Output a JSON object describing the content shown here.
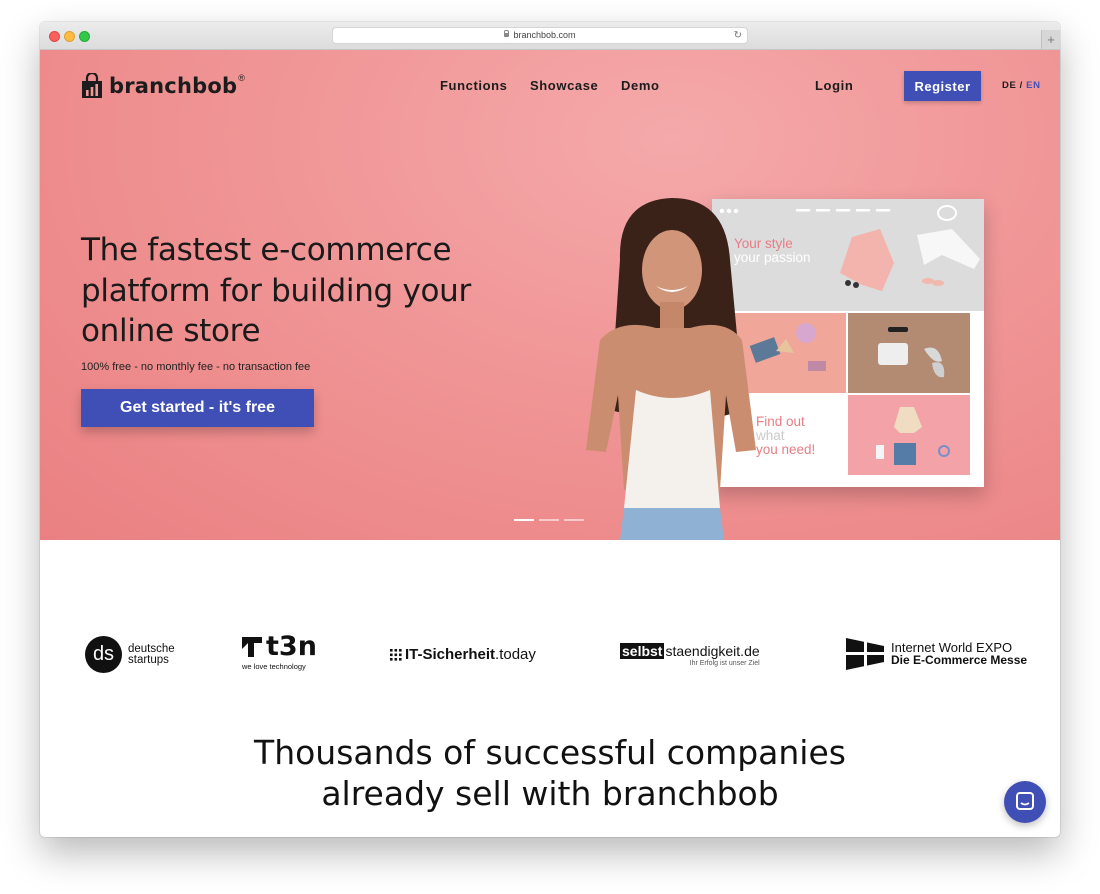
{
  "browser": {
    "url": "branchbob.com"
  },
  "header": {
    "logo_text": "branchbob",
    "logo_reg": "®",
    "nav": [
      "Functions",
      "Showcase",
      "Demo"
    ],
    "login": "Login",
    "register": "Register",
    "lang_de": "DE",
    "lang_sep": "/",
    "lang_en": "EN"
  },
  "hero": {
    "headline": "The fastest e-commerce platform for building your online store",
    "subline": "100% free - no monthly fee - no transaction fee",
    "cta": "Get started - it's free",
    "mock": {
      "text1_line1": "Your style",
      "text1_line2": "your passion",
      "text2_line1": "Find out",
      "text2_line2": "what",
      "text2_line3": "you need!"
    }
  },
  "logos": {
    "ds_mark": "ds",
    "ds_line1": "deutsche",
    "ds_line2": "startups",
    "t3n": "t3n",
    "t3n_sub": "we love technology",
    "it_sicherheit": "IT-Sicherheit",
    "it_today": ".today",
    "selbst": "selbst",
    "staendigkeit": "staendigkeit.de",
    "selbst_sub": "Ihr Erfolg ist unser Ziel",
    "iwe_line1": "Internet World EXPO",
    "iwe_line2": "Die E-Commerce Messe"
  },
  "tagline": {
    "line1": "Thousands of successful companies",
    "line2": "already sell with branchbob"
  },
  "colors": {
    "hero": "#f19899",
    "accent": "#3f4fb5"
  },
  "icons": [
    "lock-icon",
    "reload-icon",
    "shopping-bag-icon",
    "chat-icon"
  ]
}
